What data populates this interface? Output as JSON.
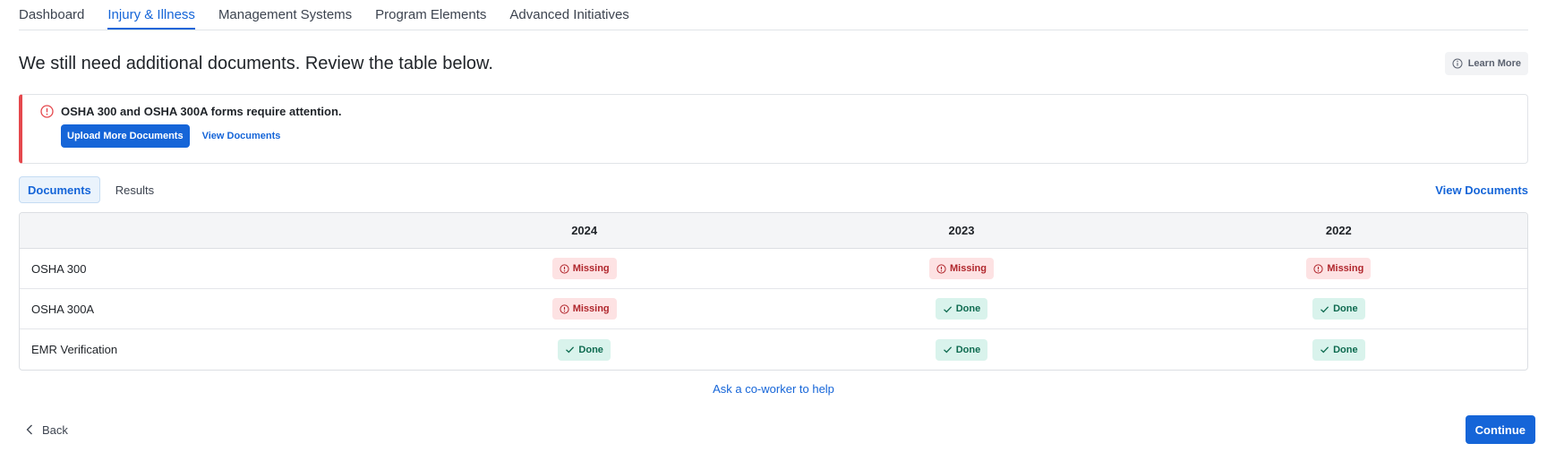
{
  "nav": {
    "tabs": [
      {
        "label": "Dashboard",
        "active": false
      },
      {
        "label": "Injury & Illness",
        "active": true
      },
      {
        "label": "Management Systems",
        "active": false
      },
      {
        "label": "Program Elements",
        "active": false
      },
      {
        "label": "Advanced Initiatives",
        "active": false
      }
    ]
  },
  "header": {
    "title": "We still need additional documents. Review the table below.",
    "learn_more_label": "Learn More",
    "learn_more_icon": "info-icon"
  },
  "alert": {
    "icon": "alert-circle-icon",
    "message": "OSHA 300 and OSHA 300A forms require attention.",
    "upload_label": "Upload More Documents",
    "view_label": "View Documents",
    "accent_color": "#e5484d"
  },
  "subtabs": {
    "tabs": [
      {
        "label": "Documents",
        "active": true
      },
      {
        "label": "Results",
        "active": false
      }
    ],
    "view_documents_label": "View Documents"
  },
  "table": {
    "years": [
      "2024",
      "2023",
      "2022"
    ],
    "rows": [
      {
        "label": "OSHA 300",
        "statuses": [
          "Missing",
          "Missing",
          "Missing"
        ]
      },
      {
        "label": "OSHA 300A",
        "statuses": [
          "Missing",
          "Done",
          "Done"
        ]
      },
      {
        "label": "EMR Verification",
        "statuses": [
          "Done",
          "Done",
          "Done"
        ]
      }
    ]
  },
  "help_link": "Ask a co-worker to help",
  "footer": {
    "back_label": "Back",
    "continue_label": "Continue"
  },
  "colors": {
    "primary": "#1565d8",
    "missing_bg": "#fde2e3",
    "missing_text": "#b0262c",
    "done_bg": "#d9f3ec",
    "done_text": "#0e6b50"
  }
}
